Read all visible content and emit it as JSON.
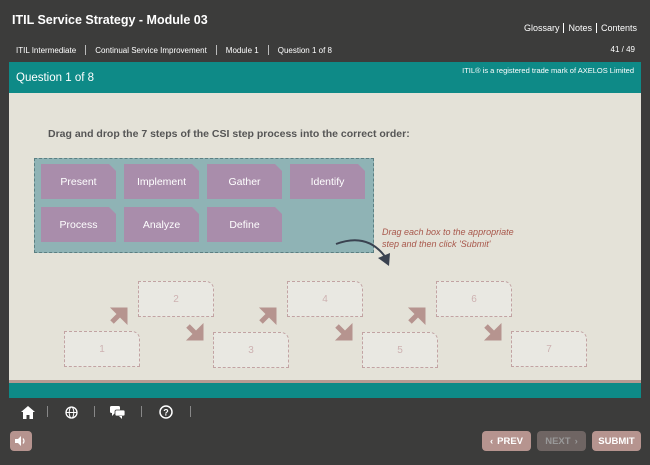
{
  "header": {
    "title": "ITIL Service Strategy - Module 03",
    "links": [
      "Glossary",
      "Notes",
      "Contents"
    ],
    "breadcrumbs": [
      "ITIL Intermediate",
      "Continual Service Improvement",
      "Module 1",
      "Question 1 of 8"
    ],
    "page_count": "41 / 49"
  },
  "question_bar": {
    "title": "Question 1 of 8",
    "trademark": "ITIL® is a registered trade mark of AXELOS Limited"
  },
  "content": {
    "instruction": "Drag and drop the 7 steps of the CSI step process into the correct order:",
    "chips": [
      "Present",
      "Implement",
      "Gather",
      "Identify",
      "Process",
      "Analyze",
      "Define"
    ],
    "hint_line1": "Drag each box to the appropriate",
    "hint_line2": "step and then click 'Submit'",
    "slots": [
      "1",
      "2",
      "3",
      "4",
      "5",
      "6",
      "7"
    ]
  },
  "toolbar": {
    "icons": [
      "home-icon",
      "globe-icon",
      "chat-icon",
      "help-icon"
    ]
  },
  "footer": {
    "prev": "PREV",
    "next": "NEXT",
    "submit": "SUBMIT"
  },
  "colors": {
    "teal": "#0e8a87",
    "chip": "#a98dab",
    "tray": "#8fb3b5",
    "accent": "#b6948f"
  }
}
